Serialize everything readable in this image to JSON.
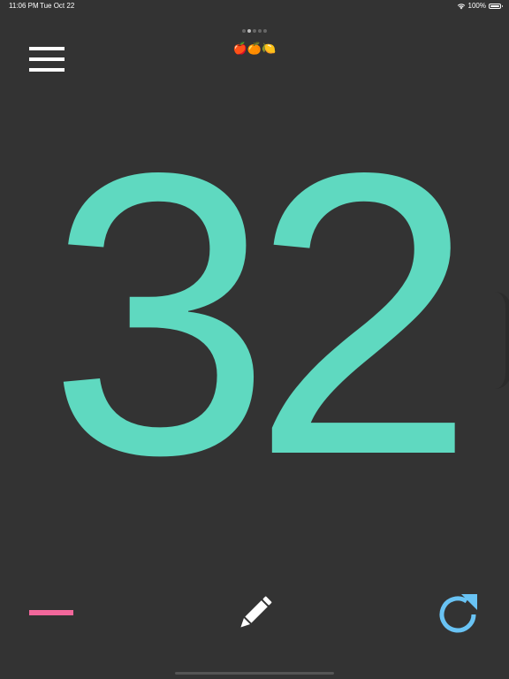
{
  "status_bar": {
    "time": "11:06 PM",
    "date": "Tue Oct 22",
    "battery": "100%",
    "battery_level": 1.0
  },
  "page_indicator": {
    "count": 5,
    "active_index": 1
  },
  "counter": {
    "fruit_emoji": "🍎🍊🍋",
    "value": "32"
  },
  "colors": {
    "background": "#333333",
    "counter": "#5fd9c0",
    "decrement": "#f2679b",
    "edit": "#ffffff",
    "reset": "#69c3f4",
    "menu": "#ffffff"
  },
  "icons": {
    "menu": "hamburger-menu-icon",
    "decrement": "minus-icon",
    "edit": "pencil-icon",
    "reset": "refresh-icon",
    "wifi": "wifi-icon",
    "battery": "battery-icon"
  }
}
